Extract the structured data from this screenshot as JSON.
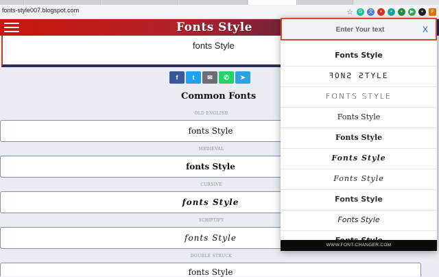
{
  "browser": {
    "url": "fonts-style007.blogspot.com",
    "extensions": [
      {
        "icon": "grammarly-icon",
        "color": "#15c39a",
        "glyph": "G"
      },
      {
        "icon": "translate-icon",
        "color": "#4a79d8",
        "glyph": "文"
      },
      {
        "icon": "red-extension-icon",
        "color": "#d93025",
        "glyph": "•"
      },
      {
        "icon": "teal-extension-icon",
        "color": "#1aa39c",
        "glyph": "•"
      },
      {
        "icon": "green-extension-icon",
        "color": "#1e8e3e",
        "glyph": "•"
      },
      {
        "icon": "play-icon",
        "color": "#34a853",
        "glyph": "▶"
      },
      {
        "icon": "dark-extension-icon",
        "color": "#202124",
        "glyph": "•"
      },
      {
        "icon": "font-changer-extension-icon",
        "color": "#e37400",
        "glyph": "F"
      }
    ]
  },
  "site": {
    "title": "Fonts Style",
    "input_value": "fonts Style",
    "section_title": "Common Fonts",
    "categories": [
      {
        "label": "OLD ENGLISH",
        "text": "fonts Style"
      },
      {
        "label": "MEDIEVAL",
        "text": "fonts Style"
      },
      {
        "label": "CURSIVE",
        "text": "fonts Style"
      },
      {
        "label": "SCRIPTIFY",
        "text": "fonts Style"
      },
      {
        "label": "DOUBLE STRUCK",
        "text": "fonts Style"
      }
    ],
    "share": [
      {
        "icon": "facebook-icon",
        "color": "#3b5998",
        "glyph": "f"
      },
      {
        "icon": "twitter-icon",
        "color": "#1da1f2",
        "glyph": "t"
      },
      {
        "icon": "email-icon",
        "color": "#6b6f75",
        "glyph": "✉"
      },
      {
        "icon": "whatsapp-icon",
        "color": "#25d366",
        "glyph": "✆"
      },
      {
        "icon": "telegram-icon",
        "color": "#2aa3e0",
        "glyph": "➤"
      }
    ]
  },
  "popup": {
    "placeholder": "Enter Your text",
    "close_label": "X",
    "items": [
      "Fonts Style",
      "ꟻONꙄ ꙄTYLE",
      "FONTS STYLE",
      "Fonts Style",
      "Fonts Style",
      "Fonts Style",
      "Fonts Style",
      "Fonts Style",
      "Fonts Style",
      "Fonts Style"
    ],
    "footer": "WWW.FONT-CHANGER.COM"
  }
}
